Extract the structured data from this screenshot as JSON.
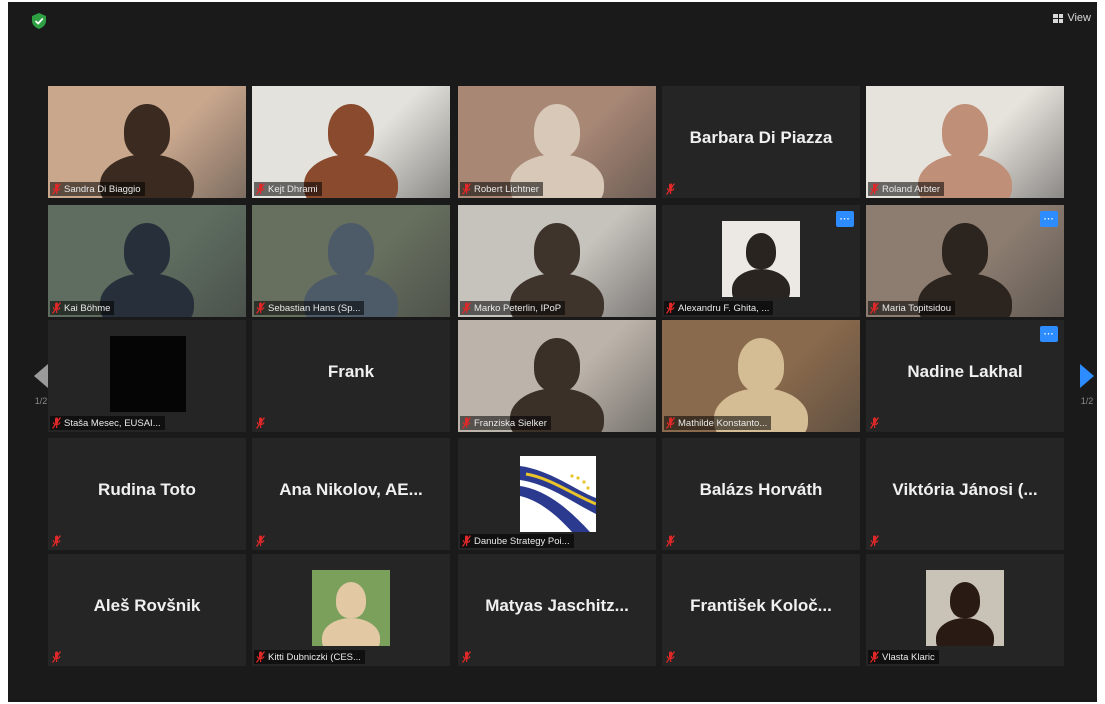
{
  "header": {
    "view_label": "View"
  },
  "pagination": {
    "left": "1/2",
    "right": "1/2"
  },
  "colors": {
    "accent": "#2d8cff",
    "active_speaker": "#c6d13a",
    "muted": "#e02828",
    "shield": "#2ea043"
  },
  "icons": {
    "security": "shield-check-icon",
    "view": "grid-view-icon",
    "mute": "mic-muted-icon",
    "prev": "chevron-left-icon",
    "next": "chevron-right-icon"
  },
  "participants": [
    {
      "label": "Sandra Di Biaggio",
      "display_name": "",
      "video": true,
      "active": true,
      "bg": "#c9a78d",
      "fg": "#3a2a20"
    },
    {
      "label": "Kejt Dhrami",
      "display_name": "",
      "video": true,
      "bg": "#e4e2dc",
      "fg": "#8a4a2e"
    },
    {
      "label": "Robert Lichtner",
      "display_name": "",
      "video": true,
      "bg": "#a88775",
      "fg": "#d8c8b8"
    },
    {
      "label": "",
      "display_name": "Barbara Di Piazza",
      "video": false
    },
    {
      "label": "Roland Arbter",
      "display_name": "",
      "video": true,
      "bg": "#e6e2dc",
      "fg": "#c08f78"
    },
    {
      "label": "Kai Böhme",
      "display_name": "",
      "video": true,
      "bg": "#5e6d60",
      "fg": "#27303a"
    },
    {
      "label": "Sebastian Hans (Sp...",
      "display_name": "",
      "video": true,
      "bg": "#67705f",
      "fg": "#4d5a68"
    },
    {
      "label": "Marko Peterlin, IPoP",
      "display_name": "",
      "video": true,
      "bg": "#c6c2bc",
      "fg": "#3e342c"
    },
    {
      "label": "Alexandru F. Ghita, ...",
      "display_name": "",
      "video": false,
      "avatar": true,
      "bg": "#ece9e4",
      "fg": "#2a2420",
      "more": true
    },
    {
      "label": "Maria Topitsidou",
      "display_name": "",
      "video": true,
      "bg": "#8d7d70",
      "fg": "#2c241f",
      "more": true
    },
    {
      "label": "Staša Mesec, EUSAI...",
      "display_name": "",
      "video": false,
      "blackbox": true
    },
    {
      "label": "",
      "display_name": "Frank",
      "video": false
    },
    {
      "label": "Franziska Sielker",
      "display_name": "",
      "video": true,
      "bg": "#bcb4aa",
      "fg": "#3a3028"
    },
    {
      "label": "Mathilde Konstanto...",
      "display_name": "",
      "video": true,
      "bg": "#8a6a4c",
      "fg": "#d4bc94"
    },
    {
      "label": "",
      "display_name": "Nadine Lakhal",
      "video": false,
      "more": true
    },
    {
      "label": "",
      "display_name": "Rudina Toto",
      "video": false
    },
    {
      "label": "",
      "display_name": "Ana  Nikolov,  AE...",
      "video": false
    },
    {
      "label": "Danube Strategy Poi...",
      "display_name": "",
      "video": false,
      "logo": true
    },
    {
      "label": "",
      "display_name": "Balázs Horváth",
      "video": false
    },
    {
      "label": "",
      "display_name": "Viktória  Jánosi  (...",
      "video": false
    },
    {
      "label": "",
      "display_name": "Aleš Rovšnik",
      "video": false
    },
    {
      "label": "Kitti Dubniczki (CES...",
      "display_name": "",
      "video": false,
      "avatar": true,
      "bg": "#7aa05c",
      "fg": "#e2c9a4"
    },
    {
      "label": "",
      "display_name": "Matyas  Jaschitz...",
      "video": false
    },
    {
      "label": "",
      "display_name": "František  Koloč...",
      "video": false
    },
    {
      "label": "Vlasta Klaric",
      "display_name": "",
      "video": false,
      "avatar": true,
      "bg": "#c9c2b6",
      "fg": "#2a1a14"
    }
  ]
}
